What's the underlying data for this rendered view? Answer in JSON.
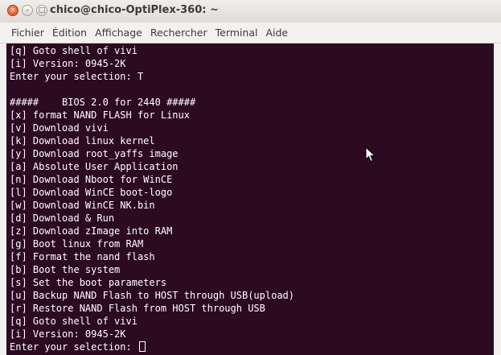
{
  "window": {
    "title": "chico@chico-OptiPlex-360: ~",
    "buttons": {
      "close": "×",
      "minimize": "–",
      "maximize": "□"
    }
  },
  "menubar": {
    "items": [
      "Fichier",
      "Édition",
      "Affichage",
      "Rechercher",
      "Terminal",
      "Aide"
    ]
  },
  "terminal": {
    "lines": [
      "[q] Goto shell of vivi",
      "[i] Version: 0945-2K",
      "Enter your selection: T",
      "",
      "#####    BIOS 2.0 for 2440 #####",
      "[x] format NAND FLASH for Linux",
      "[v] Download vivi",
      "[k] Download linux kernel",
      "[y] Download root_yaffs image",
      "[a] Absolute User Application",
      "[n] Download Nboot for WinCE",
      "[l] Download WinCE boot-logo",
      "[w] Download WinCE NK.bin",
      "[d] Download & Run",
      "[z] Download zImage into RAM",
      "[g] Boot linux from RAM",
      "[f] Format the nand flash",
      "[b] Boot the system",
      "[s] Set the boot parameters",
      "[u] Backup NAND Flash to HOST through USB(upload)",
      "[r] Restore NAND Flash from HOST through USB",
      "[q] Goto shell of vivi",
      "[i] Version: 0945-2K"
    ],
    "prompt": "Enter your selection: "
  },
  "colors": {
    "terminal_bg": "#2c0a22",
    "terminal_fg": "#ffffff",
    "close_button": "#e0461a"
  }
}
